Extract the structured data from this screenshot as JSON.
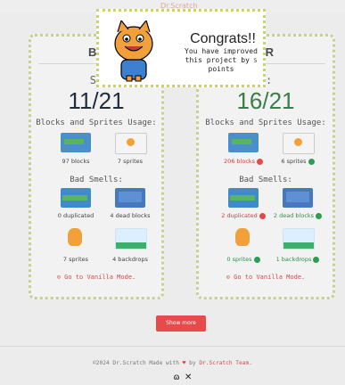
{
  "header": {
    "logo_text": "Dr.Scratch"
  },
  "modal": {
    "title": "Congrats!!",
    "message_line_1": "You have improved",
    "message_line_2_prefix": "this project by",
    "points": "5",
    "message_line_3": "points"
  },
  "before": {
    "title": "BE",
    "score_label": "Sc",
    "score": "11/21",
    "usage_title": "Blocks and Sprites Usage:",
    "blocks_caption": "97 blocks",
    "sprites_caption": "7 sprites",
    "smells_title": "Bad Smells:",
    "duplicated_caption": "0 duplicated",
    "dead_caption": "4 dead blocks",
    "sprites2_caption": "7 sprites",
    "backdrops_caption": "4 backdrops",
    "vanilla_link": "Go to Vanilla Mode."
  },
  "after": {
    "title": "ER",
    "score_label": "e:",
    "score": "16/21",
    "usage_title": "Blocks and Sprites Usage:",
    "blocks_caption": "206 blocks",
    "sprites_caption": "6 sprites",
    "smells_title": "Bad Smells:",
    "duplicated_caption": "2 duplicated",
    "dead_caption": "2 dead blocks",
    "sprites2_caption": "0 sprites",
    "backdrops_caption": "1 backdrops",
    "vanilla_link": "Go to Vanilla Mode."
  },
  "show_more": "Show more",
  "footer": {
    "prefix": "©2024 Dr.Scratch Made with",
    "by": "by",
    "team": "Dr.Scratch Team.",
    "social_1": "github-icon",
    "social_2": "x-icon"
  }
}
